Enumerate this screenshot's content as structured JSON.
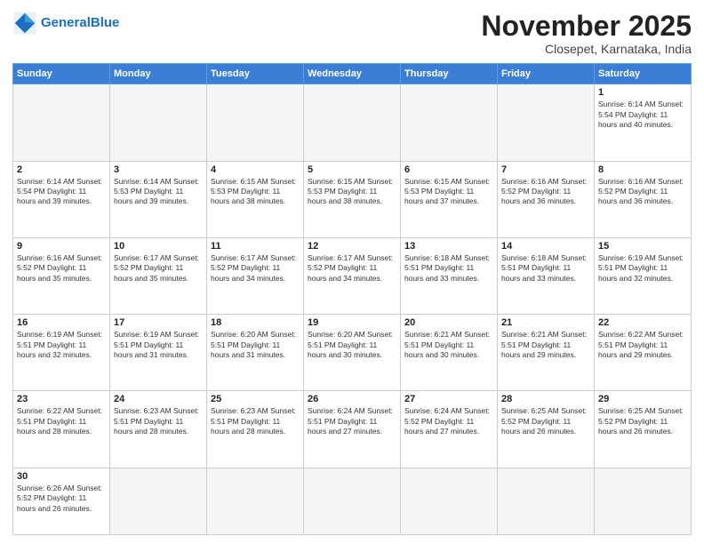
{
  "header": {
    "logo_general": "General",
    "logo_blue": "Blue",
    "month_title": "November 2025",
    "subtitle": "Closepet, Karnataka, India"
  },
  "days_of_week": [
    "Sunday",
    "Monday",
    "Tuesday",
    "Wednesday",
    "Thursday",
    "Friday",
    "Saturday"
  ],
  "weeks": [
    [
      {
        "day": "",
        "text": ""
      },
      {
        "day": "",
        "text": ""
      },
      {
        "day": "",
        "text": ""
      },
      {
        "day": "",
        "text": ""
      },
      {
        "day": "",
        "text": ""
      },
      {
        "day": "",
        "text": ""
      },
      {
        "day": "1",
        "text": "Sunrise: 6:14 AM\nSunset: 5:54 PM\nDaylight: 11 hours\nand 40 minutes."
      }
    ],
    [
      {
        "day": "2",
        "text": "Sunrise: 6:14 AM\nSunset: 5:54 PM\nDaylight: 11 hours\nand 39 minutes."
      },
      {
        "day": "3",
        "text": "Sunrise: 6:14 AM\nSunset: 5:53 PM\nDaylight: 11 hours\nand 39 minutes."
      },
      {
        "day": "4",
        "text": "Sunrise: 6:15 AM\nSunset: 5:53 PM\nDaylight: 11 hours\nand 38 minutes."
      },
      {
        "day": "5",
        "text": "Sunrise: 6:15 AM\nSunset: 5:53 PM\nDaylight: 11 hours\nand 38 minutes."
      },
      {
        "day": "6",
        "text": "Sunrise: 6:15 AM\nSunset: 5:53 PM\nDaylight: 11 hours\nand 37 minutes."
      },
      {
        "day": "7",
        "text": "Sunrise: 6:16 AM\nSunset: 5:52 PM\nDaylight: 11 hours\nand 36 minutes."
      },
      {
        "day": "8",
        "text": "Sunrise: 6:16 AM\nSunset: 5:52 PM\nDaylight: 11 hours\nand 36 minutes."
      }
    ],
    [
      {
        "day": "9",
        "text": "Sunrise: 6:16 AM\nSunset: 5:52 PM\nDaylight: 11 hours\nand 35 minutes."
      },
      {
        "day": "10",
        "text": "Sunrise: 6:17 AM\nSunset: 5:52 PM\nDaylight: 11 hours\nand 35 minutes."
      },
      {
        "day": "11",
        "text": "Sunrise: 6:17 AM\nSunset: 5:52 PM\nDaylight: 11 hours\nand 34 minutes."
      },
      {
        "day": "12",
        "text": "Sunrise: 6:17 AM\nSunset: 5:52 PM\nDaylight: 11 hours\nand 34 minutes."
      },
      {
        "day": "13",
        "text": "Sunrise: 6:18 AM\nSunset: 5:51 PM\nDaylight: 11 hours\nand 33 minutes."
      },
      {
        "day": "14",
        "text": "Sunrise: 6:18 AM\nSunset: 5:51 PM\nDaylight: 11 hours\nand 33 minutes."
      },
      {
        "day": "15",
        "text": "Sunrise: 6:19 AM\nSunset: 5:51 PM\nDaylight: 11 hours\nand 32 minutes."
      }
    ],
    [
      {
        "day": "16",
        "text": "Sunrise: 6:19 AM\nSunset: 5:51 PM\nDaylight: 11 hours\nand 32 minutes."
      },
      {
        "day": "17",
        "text": "Sunrise: 6:19 AM\nSunset: 5:51 PM\nDaylight: 11 hours\nand 31 minutes."
      },
      {
        "day": "18",
        "text": "Sunrise: 6:20 AM\nSunset: 5:51 PM\nDaylight: 11 hours\nand 31 minutes."
      },
      {
        "day": "19",
        "text": "Sunrise: 6:20 AM\nSunset: 5:51 PM\nDaylight: 11 hours\nand 30 minutes."
      },
      {
        "day": "20",
        "text": "Sunrise: 6:21 AM\nSunset: 5:51 PM\nDaylight: 11 hours\nand 30 minutes."
      },
      {
        "day": "21",
        "text": "Sunrise: 6:21 AM\nSunset: 5:51 PM\nDaylight: 11 hours\nand 29 minutes."
      },
      {
        "day": "22",
        "text": "Sunrise: 6:22 AM\nSunset: 5:51 PM\nDaylight: 11 hours\nand 29 minutes."
      }
    ],
    [
      {
        "day": "23",
        "text": "Sunrise: 6:22 AM\nSunset: 5:51 PM\nDaylight: 11 hours\nand 28 minutes."
      },
      {
        "day": "24",
        "text": "Sunrise: 6:23 AM\nSunset: 5:51 PM\nDaylight: 11 hours\nand 28 minutes."
      },
      {
        "day": "25",
        "text": "Sunrise: 6:23 AM\nSunset: 5:51 PM\nDaylight: 11 hours\nand 28 minutes."
      },
      {
        "day": "26",
        "text": "Sunrise: 6:24 AM\nSunset: 5:51 PM\nDaylight: 11 hours\nand 27 minutes."
      },
      {
        "day": "27",
        "text": "Sunrise: 6:24 AM\nSunset: 5:52 PM\nDaylight: 11 hours\nand 27 minutes."
      },
      {
        "day": "28",
        "text": "Sunrise: 6:25 AM\nSunset: 5:52 PM\nDaylight: 11 hours\nand 26 minutes."
      },
      {
        "day": "29",
        "text": "Sunrise: 6:25 AM\nSunset: 5:52 PM\nDaylight: 11 hours\nand 26 minutes."
      }
    ],
    [
      {
        "day": "30",
        "text": "Sunrise: 6:26 AM\nSunset: 5:52 PM\nDaylight: 11 hours\nand 26 minutes."
      },
      {
        "day": "",
        "text": ""
      },
      {
        "day": "",
        "text": ""
      },
      {
        "day": "",
        "text": ""
      },
      {
        "day": "",
        "text": ""
      },
      {
        "day": "",
        "text": ""
      },
      {
        "day": "",
        "text": ""
      }
    ]
  ]
}
